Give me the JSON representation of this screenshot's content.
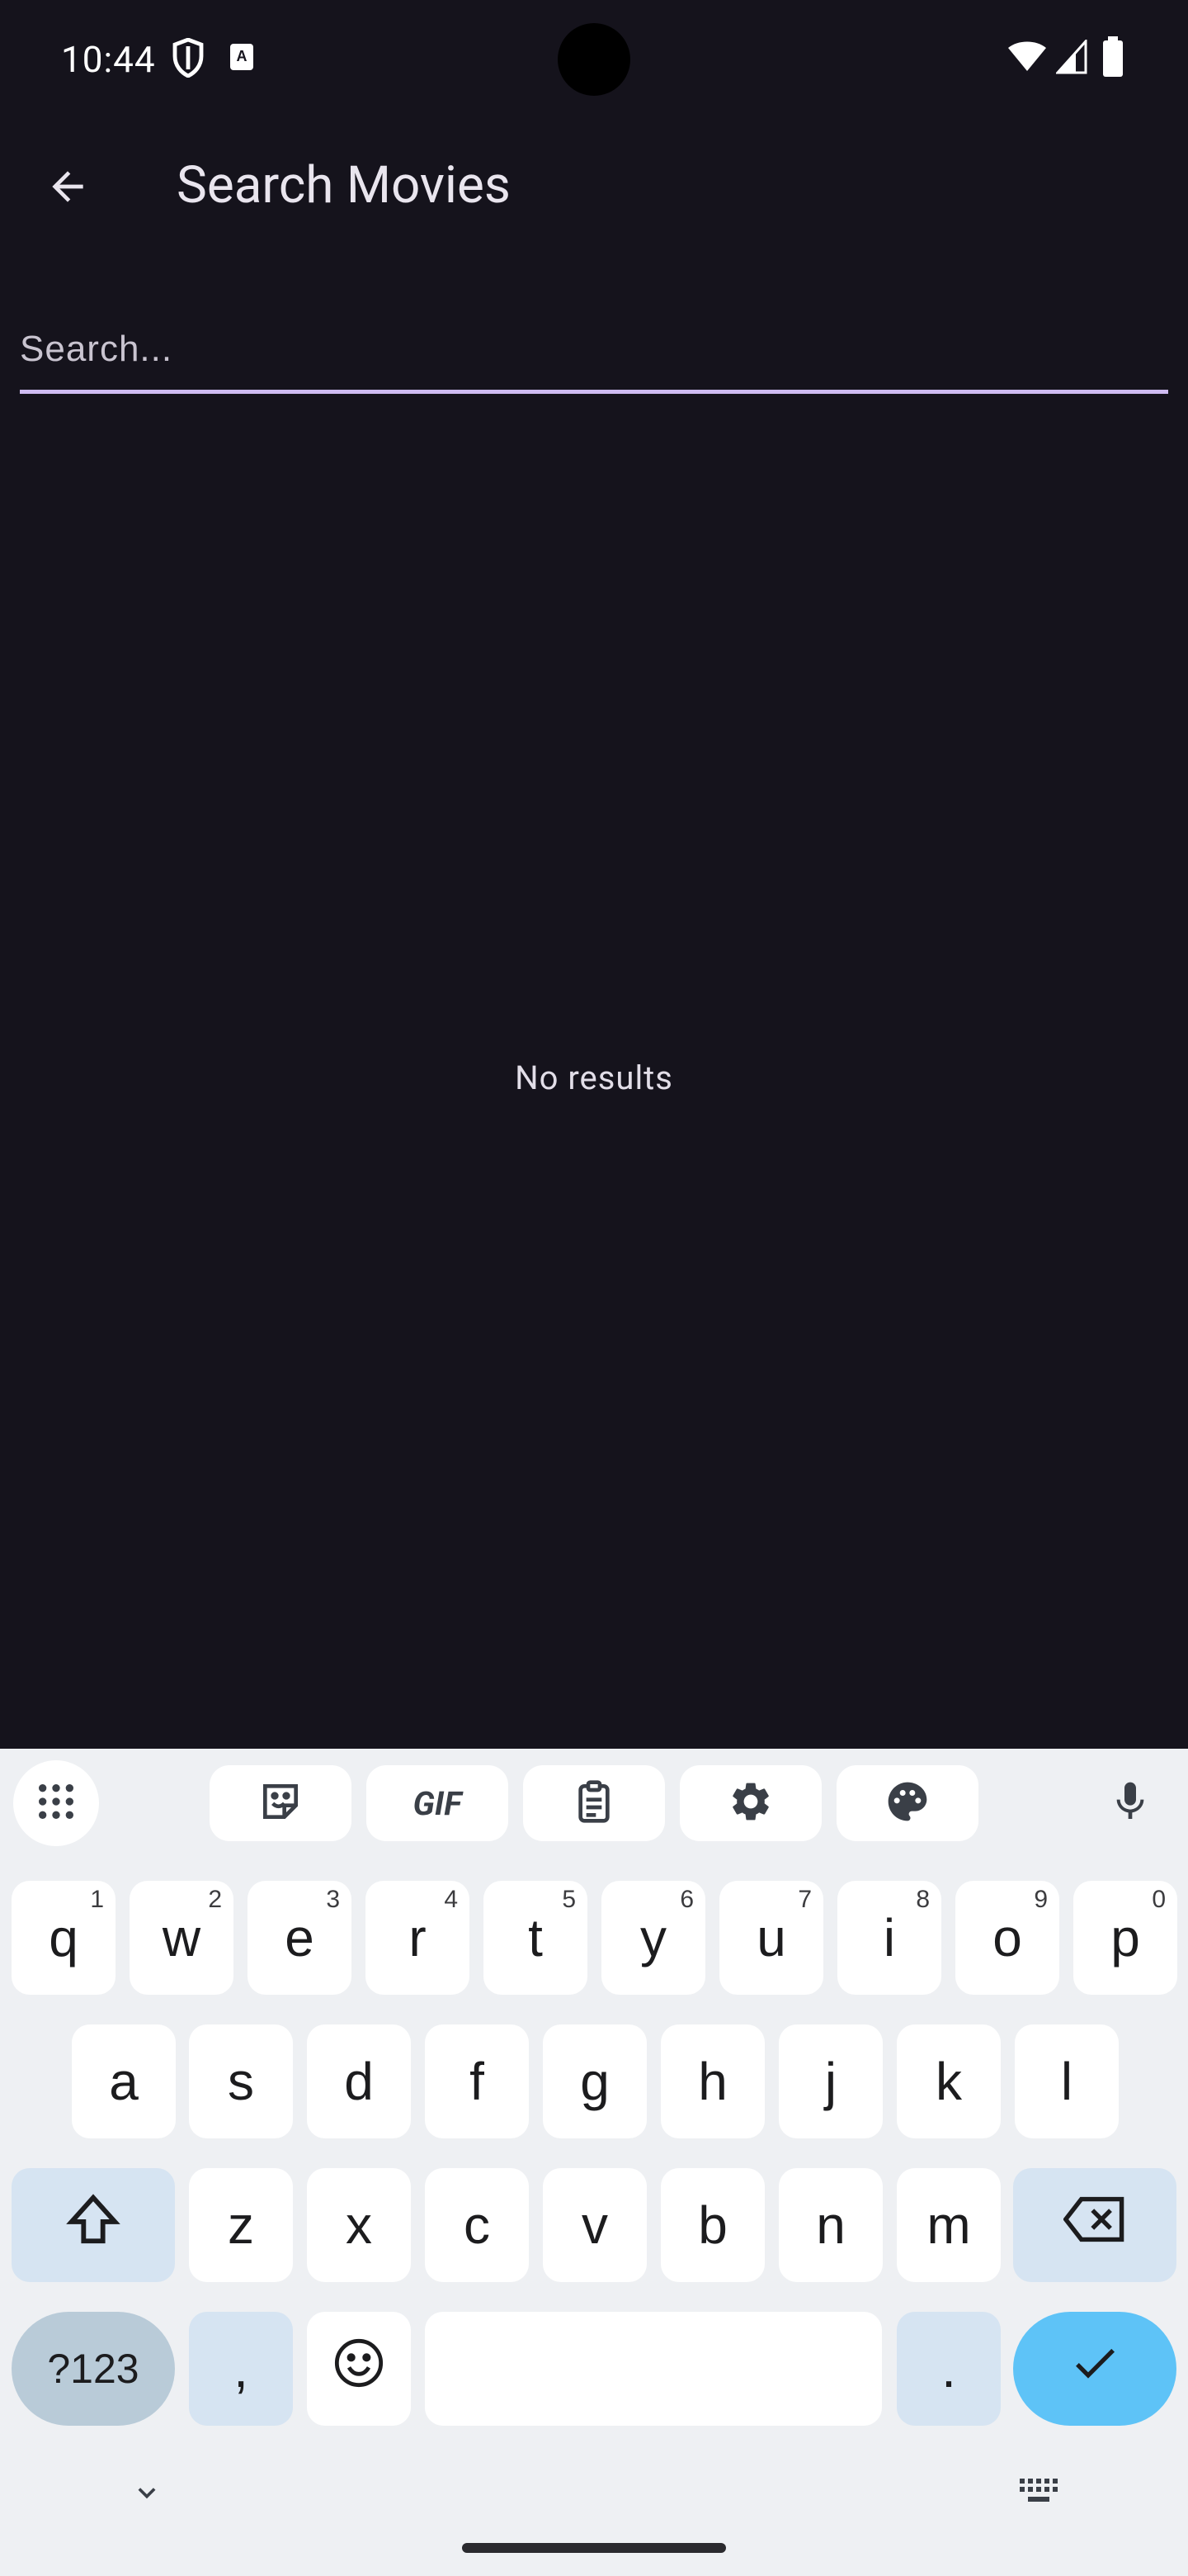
{
  "status_bar": {
    "time": "10:44"
  },
  "app_bar": {
    "title": "Search Movies"
  },
  "search": {
    "placeholder": "Search...",
    "value": ""
  },
  "results": {
    "empty_text": "No results"
  },
  "keyboard": {
    "toolbar": [
      "apps-grid-icon",
      "sticker-icon",
      "GIF",
      "clipboard-icon",
      "settings-icon",
      "palette-icon",
      "mic-icon"
    ],
    "row1": [
      {
        "k": "q",
        "n": "1"
      },
      {
        "k": "w",
        "n": "2"
      },
      {
        "k": "e",
        "n": "3"
      },
      {
        "k": "r",
        "n": "4"
      },
      {
        "k": "t",
        "n": "5"
      },
      {
        "k": "y",
        "n": "6"
      },
      {
        "k": "u",
        "n": "7"
      },
      {
        "k": "i",
        "n": "8"
      },
      {
        "k": "o",
        "n": "9"
      },
      {
        "k": "p",
        "n": "0"
      }
    ],
    "row2": [
      "a",
      "s",
      "d",
      "f",
      "g",
      "h",
      "j",
      "k",
      "l"
    ],
    "row3": [
      "z",
      "x",
      "c",
      "v",
      "b",
      "n",
      "m"
    ],
    "symbols_label": "?123",
    "comma": ",",
    "period": ".",
    "gif_label": "GIF"
  }
}
